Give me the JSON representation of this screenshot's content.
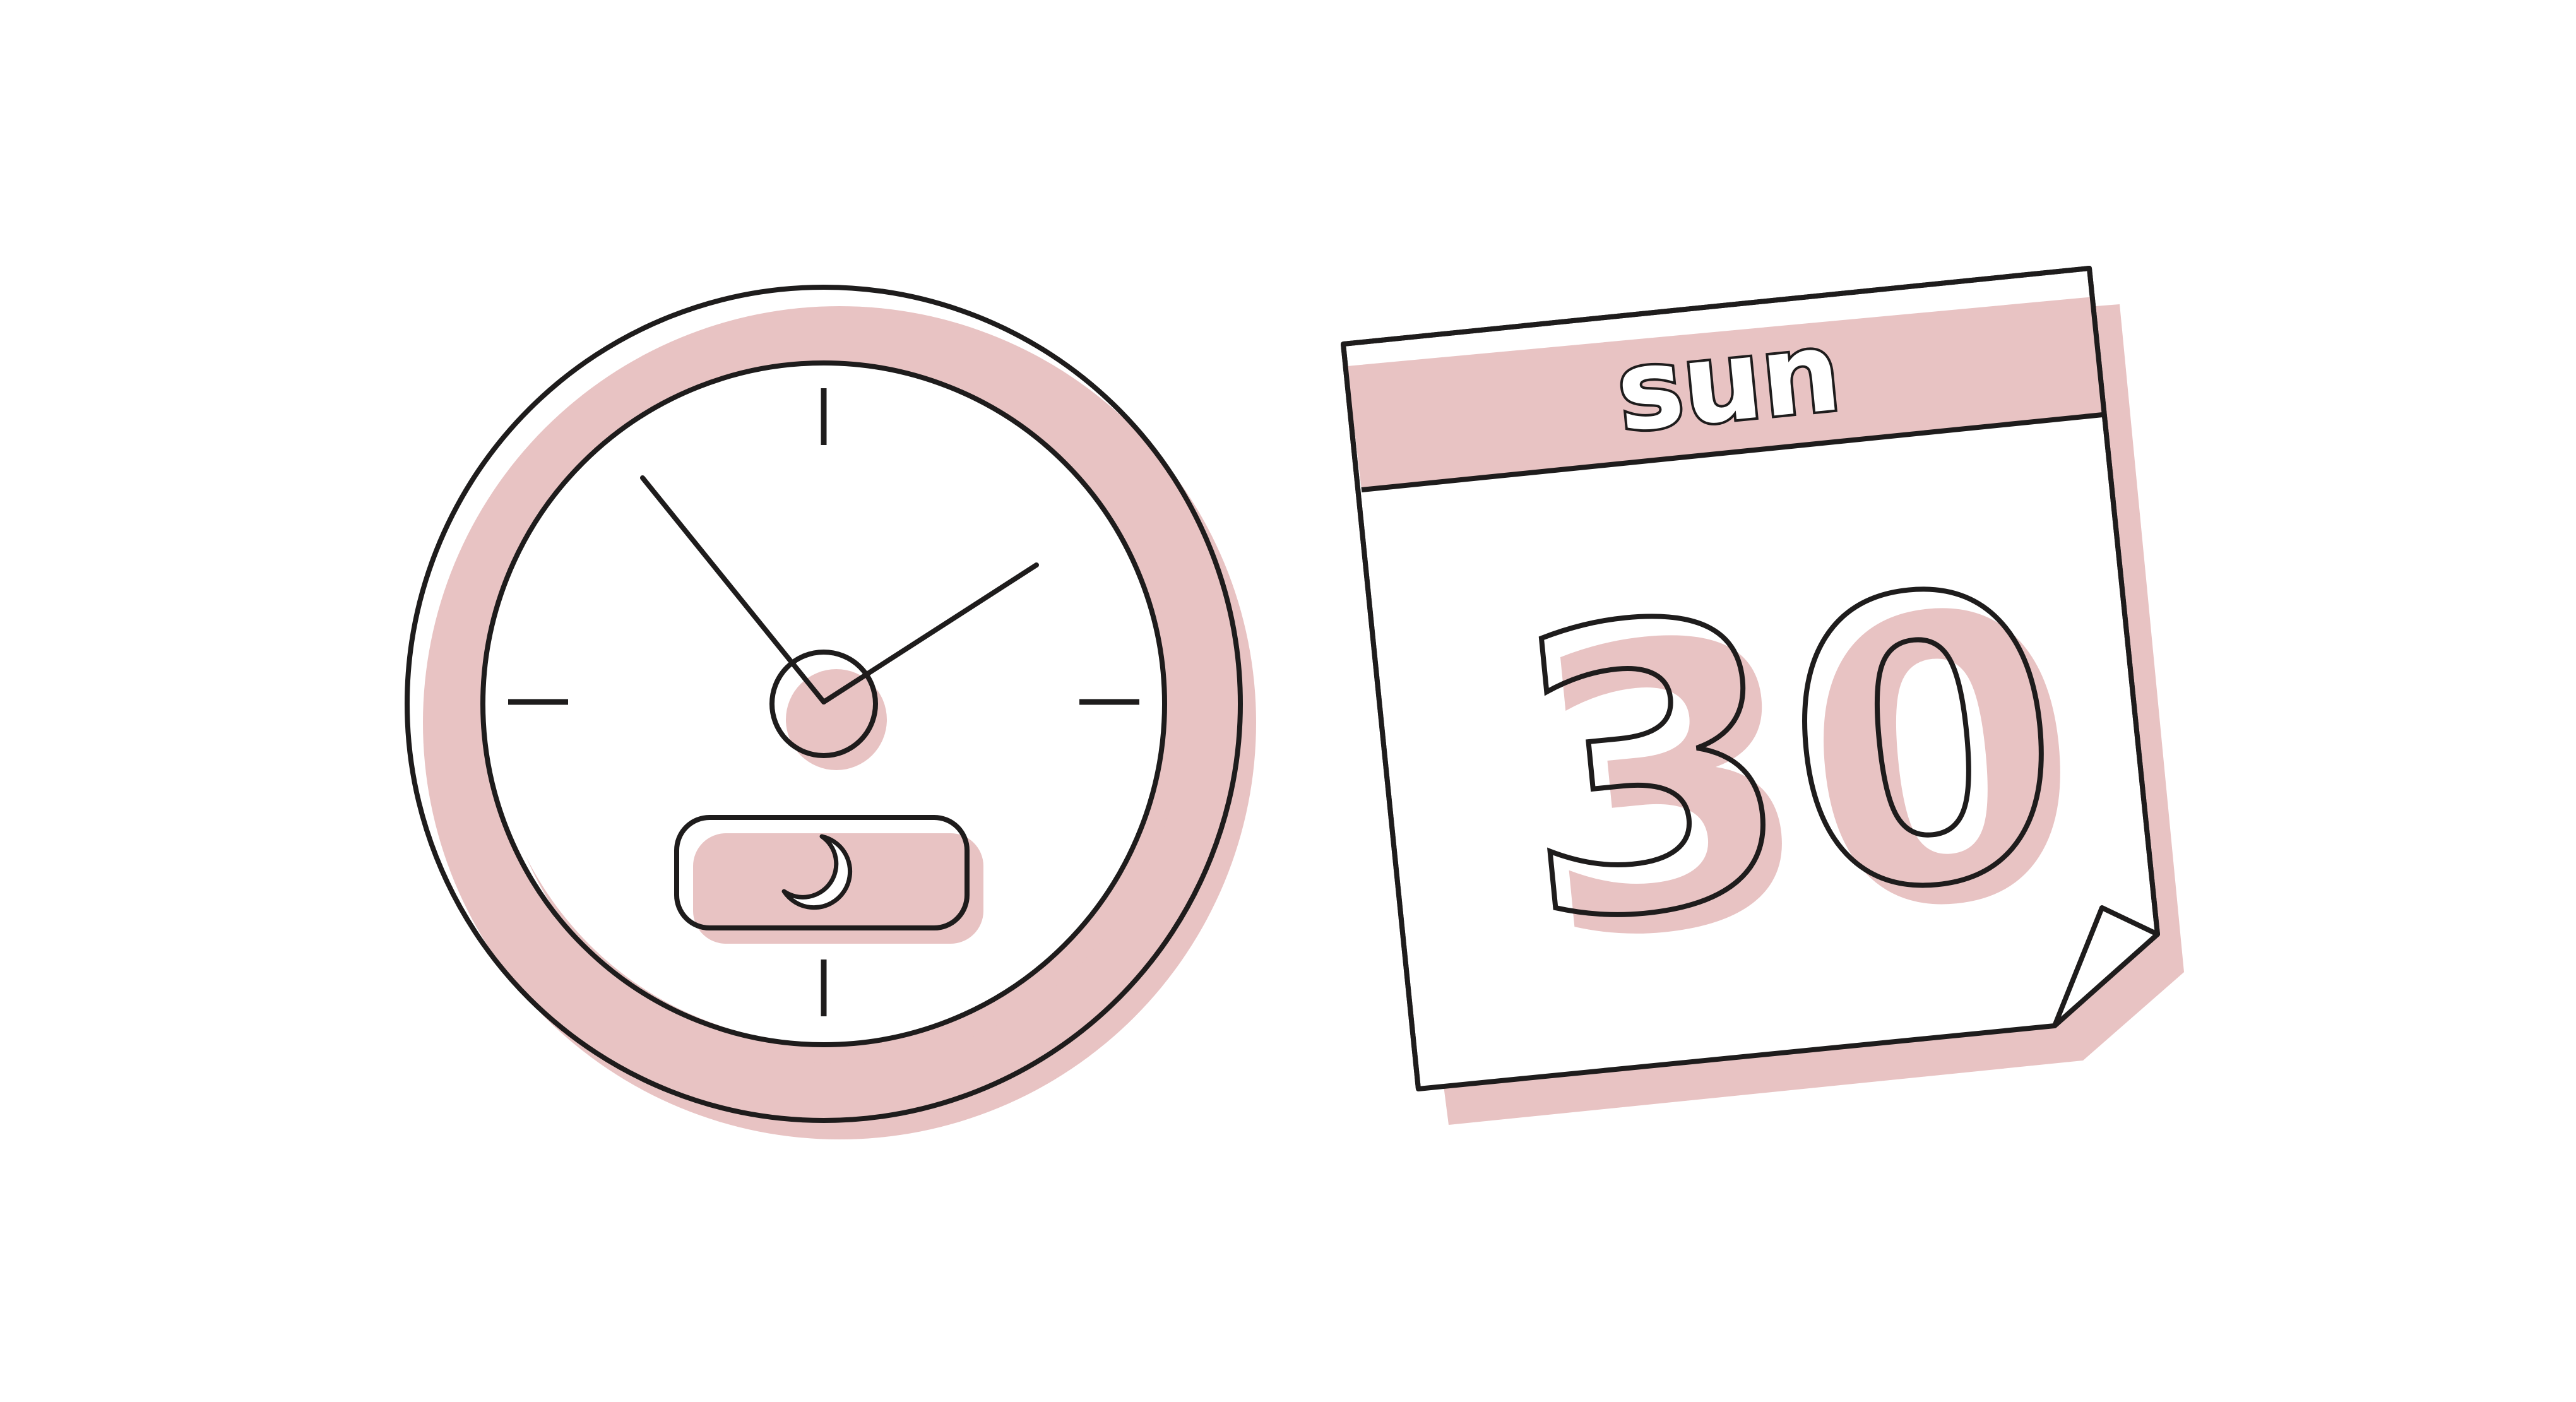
{
  "calendar": {
    "weekday": "sun",
    "day": "30"
  },
  "clock": {
    "mode_icon": "moon-icon"
  },
  "colors": {
    "accent": "#e8c3c3",
    "outline": "#1e1c1c",
    "background": "#ffffff"
  }
}
